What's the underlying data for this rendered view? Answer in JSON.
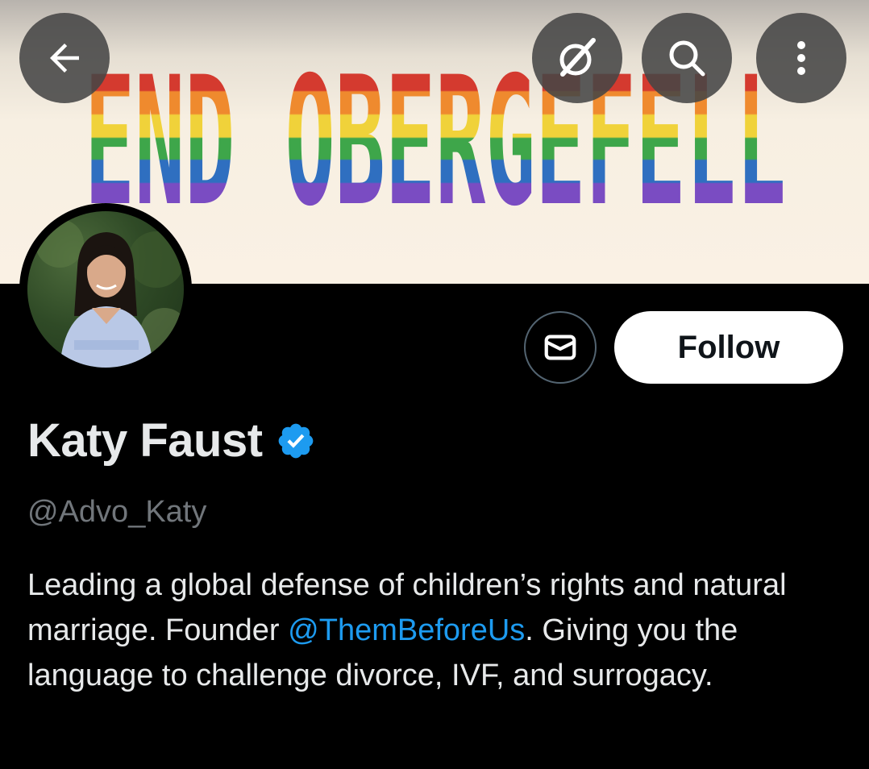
{
  "banner": {
    "text": "END OBERGEFELL"
  },
  "header": {
    "back_icon": "arrow-left-icon",
    "grok_icon": "grok-icon",
    "search_icon": "search-icon",
    "more_icon": "more-vertical-icon"
  },
  "profile": {
    "name": "Katy Faust",
    "verified_color": "#1d9bf0",
    "handle": "@Advo_Katy",
    "bio_part1": "Leading a global defense of children’s rights and natural marriage. Founder ",
    "bio_mention": "@ThemBeforeUs",
    "bio_part2": ". Giving you the language to challenge divorce, IVF, and surrogacy."
  },
  "actions": {
    "message_icon": "envelope-icon",
    "follow_label": "Follow"
  },
  "colors": {
    "accent": "#1d9bf0",
    "background": "#000000",
    "text_primary": "#e7e9ea",
    "text_secondary": "#71767b"
  }
}
